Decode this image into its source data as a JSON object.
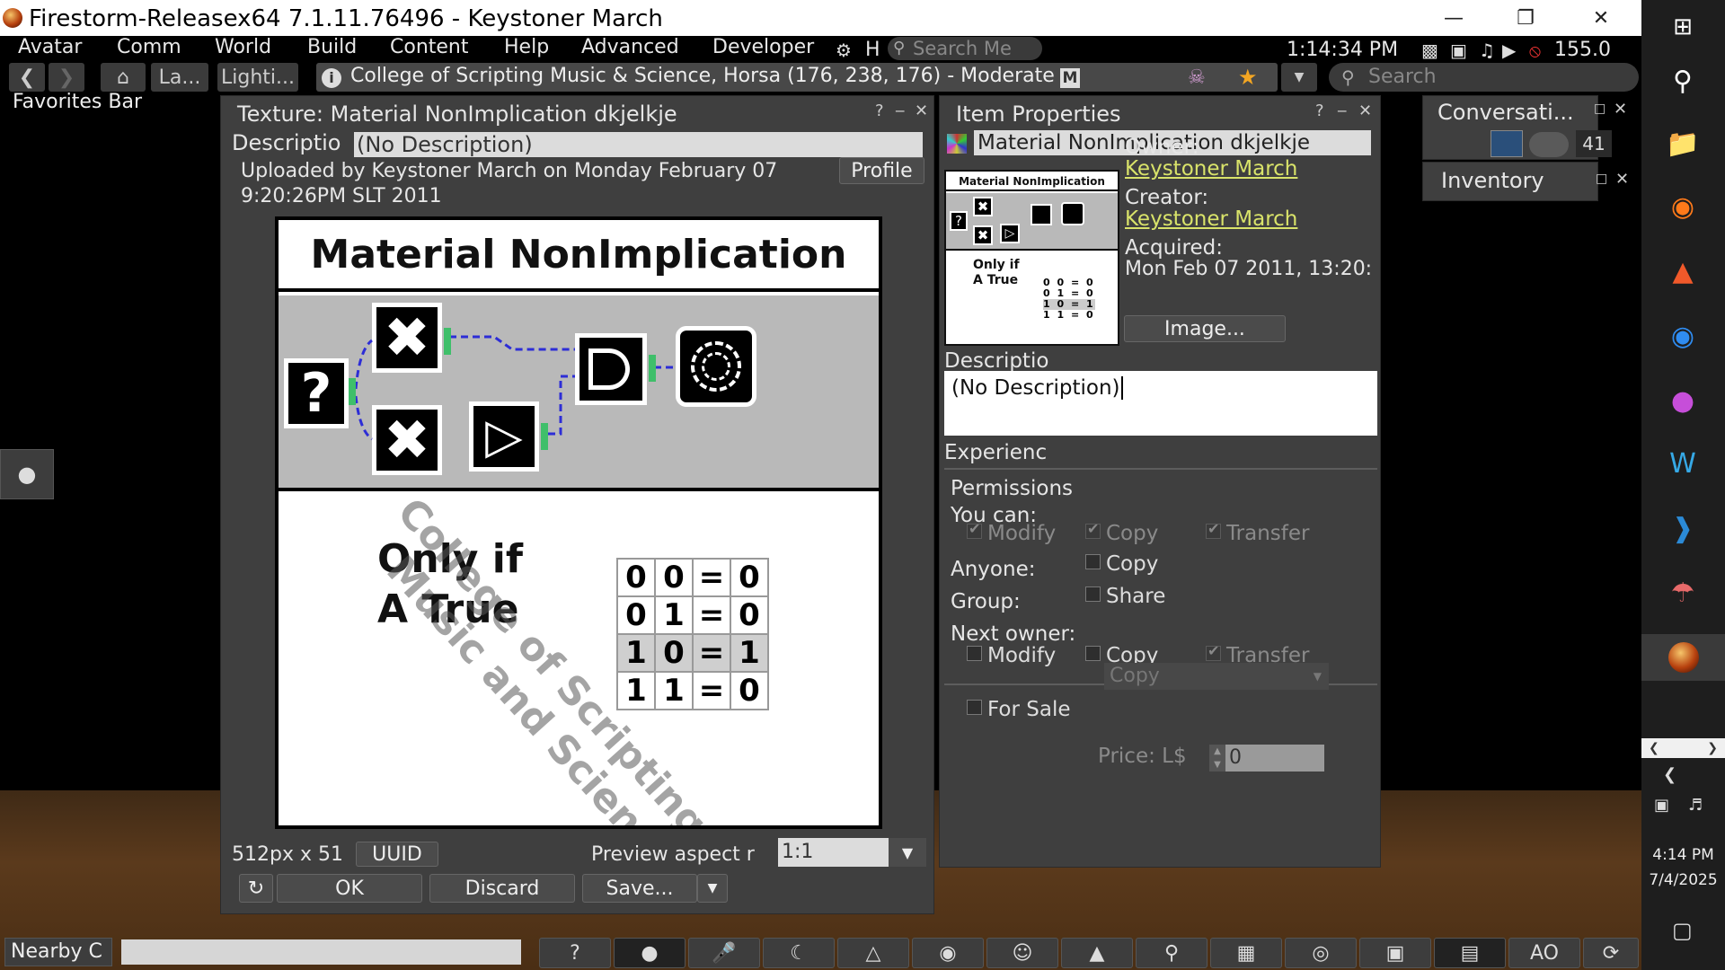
{
  "window": {
    "title": "Firestorm-Releasex64 7.1.11.76496 - Keystoner March"
  },
  "menu": {
    "items": [
      "Avatar",
      "Comm",
      "World",
      "Build",
      "Content",
      "Help",
      "Advanced",
      "Developer"
    ],
    "h_label": "H",
    "search_placeholder": "Search Me",
    "clock": "1:14:34 PM",
    "balance": "155.0"
  },
  "nav": {
    "landmarks_label": "La...",
    "lighting_label": "Lighti...",
    "location": "College of Scripting Music & Science, Horsa (176, 238, 176) - Moderate",
    "rating_badge": "M",
    "search_placeholder": "Search"
  },
  "favorites_bar": "Favorites Bar",
  "texture_floater": {
    "title": "Texture: Material NonImplication dkjelkje",
    "help": "?",
    "minimize": "‒",
    "close": "✕",
    "desc_label": "Descriptio",
    "desc_value": "(No Description)",
    "uploaded": "Uploaded by Keystoner March on Monday February 07 9:20:26PM SLT 2011",
    "profile_btn": "Profile",
    "size": "512px x 51",
    "uuid_btn": "UUID",
    "aspect_label": "Preview aspect r",
    "aspect_value": "1:1",
    "ok_btn": "OK",
    "discard_btn": "Discard",
    "save_btn": "Save...",
    "image": {
      "heading": "Material NonImplication",
      "caption_line1": "Only if",
      "caption_line2": "A True",
      "watermark_line1": "College of Scripting",
      "watermark_line2": "Music and Science",
      "table": [
        [
          "0",
          "0",
          "=",
          "0"
        ],
        [
          "0",
          "1",
          "=",
          "0"
        ],
        [
          "1",
          "0",
          "=",
          "1"
        ],
        [
          "1",
          "1",
          "=",
          "0"
        ]
      ]
    }
  },
  "item_properties": {
    "title": "Item Properties",
    "name": "Material NonImplication dkjelkje",
    "owner_label": "Owner:",
    "owner": "Keystoner March",
    "creator_label": "Creator:",
    "creator": "Keystoner March",
    "acquired_label": "Acquired:",
    "acquired": "Mon Feb 07 2011, 13:20:",
    "image_btn": "Image...",
    "desc_label": "Descriptio",
    "desc_value": "(No Description)",
    "experience_label": "Experienc",
    "permissions_label": "Permissions",
    "you_can_label": "You can:",
    "modify": "Modify",
    "copy": "Copy",
    "transfer": "Transfer",
    "anyone_label": "Anyone:",
    "group_label": "Group:",
    "share": "Share",
    "next_owner_label": "Next owner:",
    "for_sale": "For Sale",
    "sale_type": "Copy",
    "price_label": "Price: L$",
    "price_value": "0"
  },
  "conversations": {
    "title": "Conversati...",
    "count": "41"
  },
  "inventory": {
    "title": "Inventory"
  },
  "bottom": {
    "nearby_chat": "Nearby C",
    "ao_label": "AO"
  },
  "taskbar": {
    "time": "4:14 PM",
    "date": "7/4/2025"
  }
}
